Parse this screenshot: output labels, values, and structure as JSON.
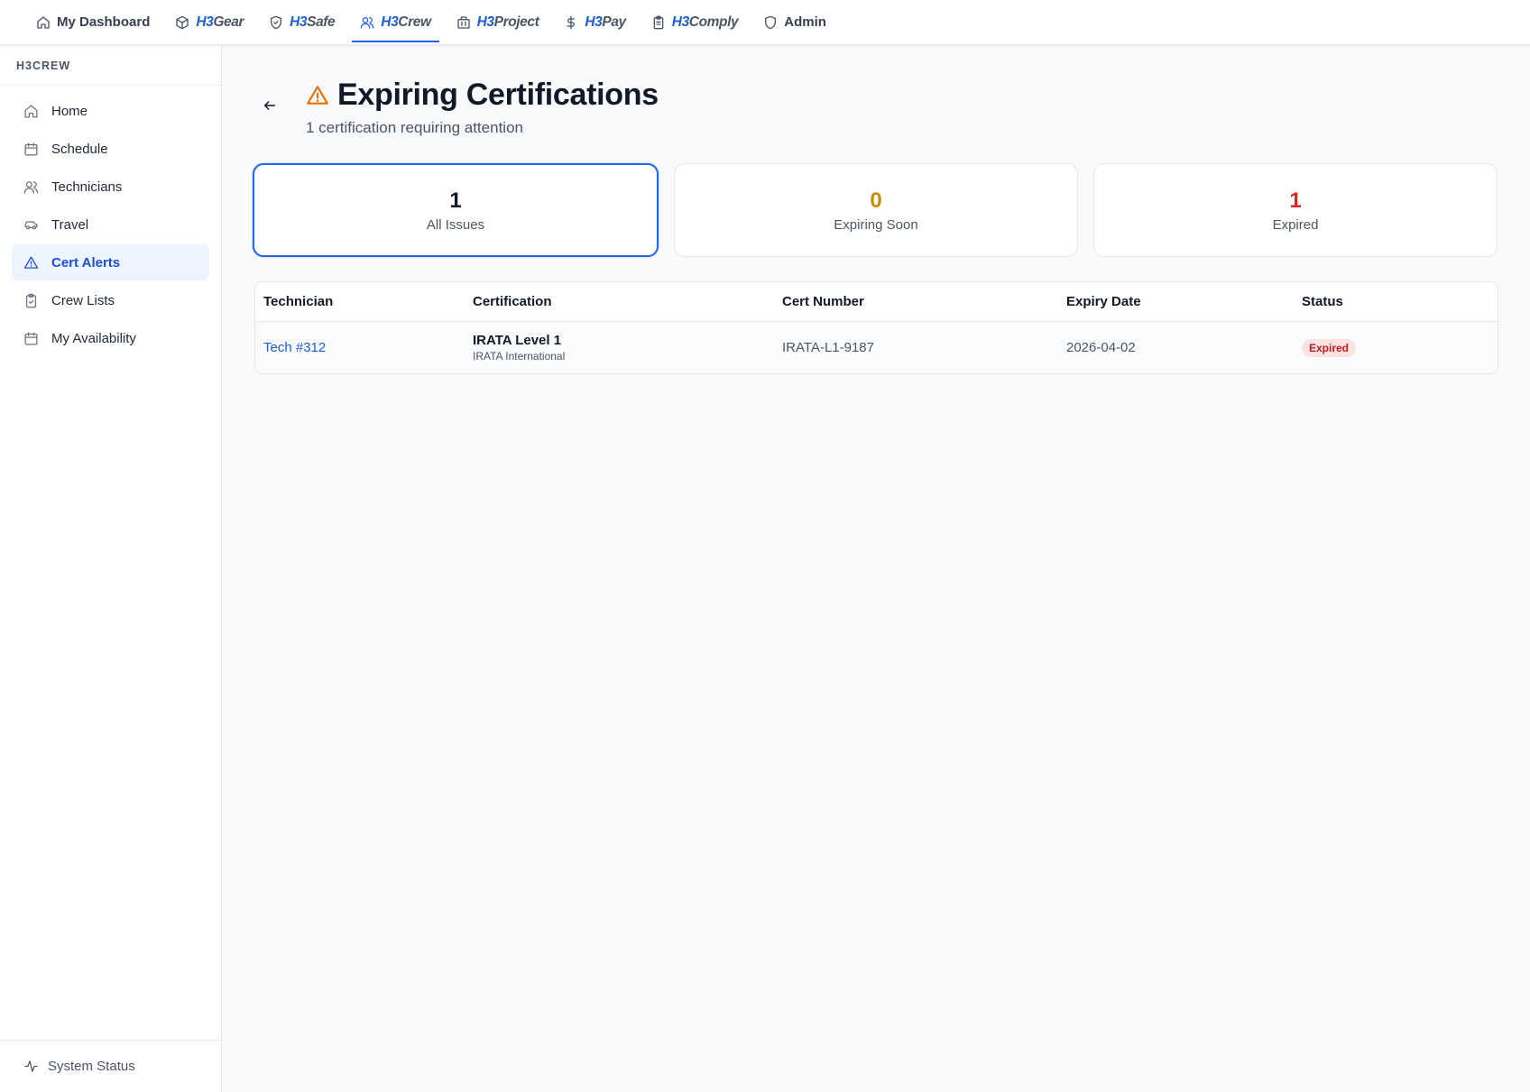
{
  "topnav": {
    "items": [
      {
        "label": "My Dashboard",
        "icon": "home-icon"
      },
      {
        "brand_prefix": "H3",
        "brand_suffix": "Gear",
        "icon": "box-icon"
      },
      {
        "brand_prefix": "H3",
        "brand_suffix": "Safe",
        "icon": "shield-check-icon"
      },
      {
        "brand_prefix": "H3",
        "brand_suffix": "Crew",
        "icon": "users-icon",
        "active": true
      },
      {
        "brand_prefix": "H3",
        "brand_suffix": "Project",
        "icon": "building-icon"
      },
      {
        "brand_prefix": "H3",
        "brand_suffix": "Pay",
        "icon": "dollar-icon"
      },
      {
        "brand_prefix": "H3",
        "brand_suffix": "Comply",
        "icon": "clipboard-icon"
      },
      {
        "label": "Admin",
        "icon": "shield-icon"
      }
    ]
  },
  "sidebar": {
    "heading": "H3CREW",
    "items": [
      {
        "label": "Home",
        "icon": "home-icon"
      },
      {
        "label": "Schedule",
        "icon": "calendar-icon"
      },
      {
        "label": "Technicians",
        "icon": "users-icon"
      },
      {
        "label": "Travel",
        "icon": "car-icon"
      },
      {
        "label": "Cert Alerts",
        "icon": "alert-triangle-icon",
        "active": true
      },
      {
        "label": "Crew Lists",
        "icon": "clipboard-check-icon"
      },
      {
        "label": "My Availability",
        "icon": "calendar-icon"
      }
    ],
    "footer": {
      "label": "System Status",
      "icon": "activity-icon"
    }
  },
  "main": {
    "title": "Expiring Certifications",
    "subtitle": "1 certification requiring attention",
    "stats": [
      {
        "value": "1",
        "label": "All Issues",
        "color": "#111827",
        "selected": true
      },
      {
        "value": "0",
        "label": "Expiring Soon",
        "color": "#ca8a04"
      },
      {
        "value": "1",
        "label": "Expired",
        "color": "#dc2626"
      }
    ],
    "table": {
      "columns": [
        "Technician",
        "Certification",
        "Cert Number",
        "Expiry Date",
        "Status"
      ],
      "rows": [
        {
          "technician": "Tech #312",
          "certification": "IRATA Level 1",
          "issuer": "IRATA International",
          "cert_number": "IRATA-L1-9187",
          "expiry_date": "2026-04-02",
          "status": "Expired"
        }
      ]
    }
  },
  "colors": {
    "accent": "#2563eb",
    "warning": "#ea6c00",
    "expired": "#dc2626",
    "expiring": "#ca8a04"
  }
}
